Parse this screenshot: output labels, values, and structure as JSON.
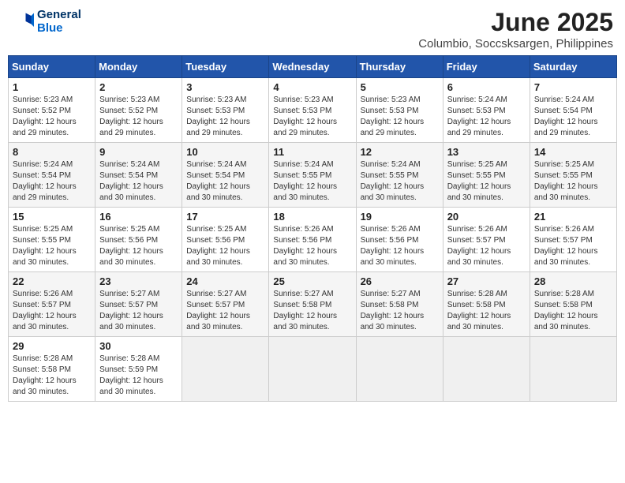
{
  "header": {
    "logo_general": "General",
    "logo_blue": "Blue",
    "title": "June 2025",
    "subtitle": "Columbio, Soccsksargen, Philippines"
  },
  "weekdays": [
    "Sunday",
    "Monday",
    "Tuesday",
    "Wednesday",
    "Thursday",
    "Friday",
    "Saturday"
  ],
  "rows": [
    [
      {
        "day": "1",
        "sunrise": "Sunrise: 5:23 AM",
        "sunset": "Sunset: 5:52 PM",
        "daylight": "Daylight: 12 hours and 29 minutes."
      },
      {
        "day": "2",
        "sunrise": "Sunrise: 5:23 AM",
        "sunset": "Sunset: 5:52 PM",
        "daylight": "Daylight: 12 hours and 29 minutes."
      },
      {
        "day": "3",
        "sunrise": "Sunrise: 5:23 AM",
        "sunset": "Sunset: 5:53 PM",
        "daylight": "Daylight: 12 hours and 29 minutes."
      },
      {
        "day": "4",
        "sunrise": "Sunrise: 5:23 AM",
        "sunset": "Sunset: 5:53 PM",
        "daylight": "Daylight: 12 hours and 29 minutes."
      },
      {
        "day": "5",
        "sunrise": "Sunrise: 5:23 AM",
        "sunset": "Sunset: 5:53 PM",
        "daylight": "Daylight: 12 hours and 29 minutes."
      },
      {
        "day": "6",
        "sunrise": "Sunrise: 5:24 AM",
        "sunset": "Sunset: 5:53 PM",
        "daylight": "Daylight: 12 hours and 29 minutes."
      },
      {
        "day": "7",
        "sunrise": "Sunrise: 5:24 AM",
        "sunset": "Sunset: 5:54 PM",
        "daylight": "Daylight: 12 hours and 29 minutes."
      }
    ],
    [
      {
        "day": "8",
        "sunrise": "Sunrise: 5:24 AM",
        "sunset": "Sunset: 5:54 PM",
        "daylight": "Daylight: 12 hours and 29 minutes."
      },
      {
        "day": "9",
        "sunrise": "Sunrise: 5:24 AM",
        "sunset": "Sunset: 5:54 PM",
        "daylight": "Daylight: 12 hours and 30 minutes."
      },
      {
        "day": "10",
        "sunrise": "Sunrise: 5:24 AM",
        "sunset": "Sunset: 5:54 PM",
        "daylight": "Daylight: 12 hours and 30 minutes."
      },
      {
        "day": "11",
        "sunrise": "Sunrise: 5:24 AM",
        "sunset": "Sunset: 5:55 PM",
        "daylight": "Daylight: 12 hours and 30 minutes."
      },
      {
        "day": "12",
        "sunrise": "Sunrise: 5:24 AM",
        "sunset": "Sunset: 5:55 PM",
        "daylight": "Daylight: 12 hours and 30 minutes."
      },
      {
        "day": "13",
        "sunrise": "Sunrise: 5:25 AM",
        "sunset": "Sunset: 5:55 PM",
        "daylight": "Daylight: 12 hours and 30 minutes."
      },
      {
        "day": "14",
        "sunrise": "Sunrise: 5:25 AM",
        "sunset": "Sunset: 5:55 PM",
        "daylight": "Daylight: 12 hours and 30 minutes."
      }
    ],
    [
      {
        "day": "15",
        "sunrise": "Sunrise: 5:25 AM",
        "sunset": "Sunset: 5:55 PM",
        "daylight": "Daylight: 12 hours and 30 minutes."
      },
      {
        "day": "16",
        "sunrise": "Sunrise: 5:25 AM",
        "sunset": "Sunset: 5:56 PM",
        "daylight": "Daylight: 12 hours and 30 minutes."
      },
      {
        "day": "17",
        "sunrise": "Sunrise: 5:25 AM",
        "sunset": "Sunset: 5:56 PM",
        "daylight": "Daylight: 12 hours and 30 minutes."
      },
      {
        "day": "18",
        "sunrise": "Sunrise: 5:26 AM",
        "sunset": "Sunset: 5:56 PM",
        "daylight": "Daylight: 12 hours and 30 minutes."
      },
      {
        "day": "19",
        "sunrise": "Sunrise: 5:26 AM",
        "sunset": "Sunset: 5:56 PM",
        "daylight": "Daylight: 12 hours and 30 minutes."
      },
      {
        "day": "20",
        "sunrise": "Sunrise: 5:26 AM",
        "sunset": "Sunset: 5:57 PM",
        "daylight": "Daylight: 12 hours and 30 minutes."
      },
      {
        "day": "21",
        "sunrise": "Sunrise: 5:26 AM",
        "sunset": "Sunset: 5:57 PM",
        "daylight": "Daylight: 12 hours and 30 minutes."
      }
    ],
    [
      {
        "day": "22",
        "sunrise": "Sunrise: 5:26 AM",
        "sunset": "Sunset: 5:57 PM",
        "daylight": "Daylight: 12 hours and 30 minutes."
      },
      {
        "day": "23",
        "sunrise": "Sunrise: 5:27 AM",
        "sunset": "Sunset: 5:57 PM",
        "daylight": "Daylight: 12 hours and 30 minutes."
      },
      {
        "day": "24",
        "sunrise": "Sunrise: 5:27 AM",
        "sunset": "Sunset: 5:57 PM",
        "daylight": "Daylight: 12 hours and 30 minutes."
      },
      {
        "day": "25",
        "sunrise": "Sunrise: 5:27 AM",
        "sunset": "Sunset: 5:58 PM",
        "daylight": "Daylight: 12 hours and 30 minutes."
      },
      {
        "day": "26",
        "sunrise": "Sunrise: 5:27 AM",
        "sunset": "Sunset: 5:58 PM",
        "daylight": "Daylight: 12 hours and 30 minutes."
      },
      {
        "day": "27",
        "sunrise": "Sunrise: 5:28 AM",
        "sunset": "Sunset: 5:58 PM",
        "daylight": "Daylight: 12 hours and 30 minutes."
      },
      {
        "day": "28",
        "sunrise": "Sunrise: 5:28 AM",
        "sunset": "Sunset: 5:58 PM",
        "daylight": "Daylight: 12 hours and 30 minutes."
      }
    ],
    [
      {
        "day": "29",
        "sunrise": "Sunrise: 5:28 AM",
        "sunset": "Sunset: 5:58 PM",
        "daylight": "Daylight: 12 hours and 30 minutes."
      },
      {
        "day": "30",
        "sunrise": "Sunrise: 5:28 AM",
        "sunset": "Sunset: 5:59 PM",
        "daylight": "Daylight: 12 hours and 30 minutes."
      },
      null,
      null,
      null,
      null,
      null
    ]
  ]
}
